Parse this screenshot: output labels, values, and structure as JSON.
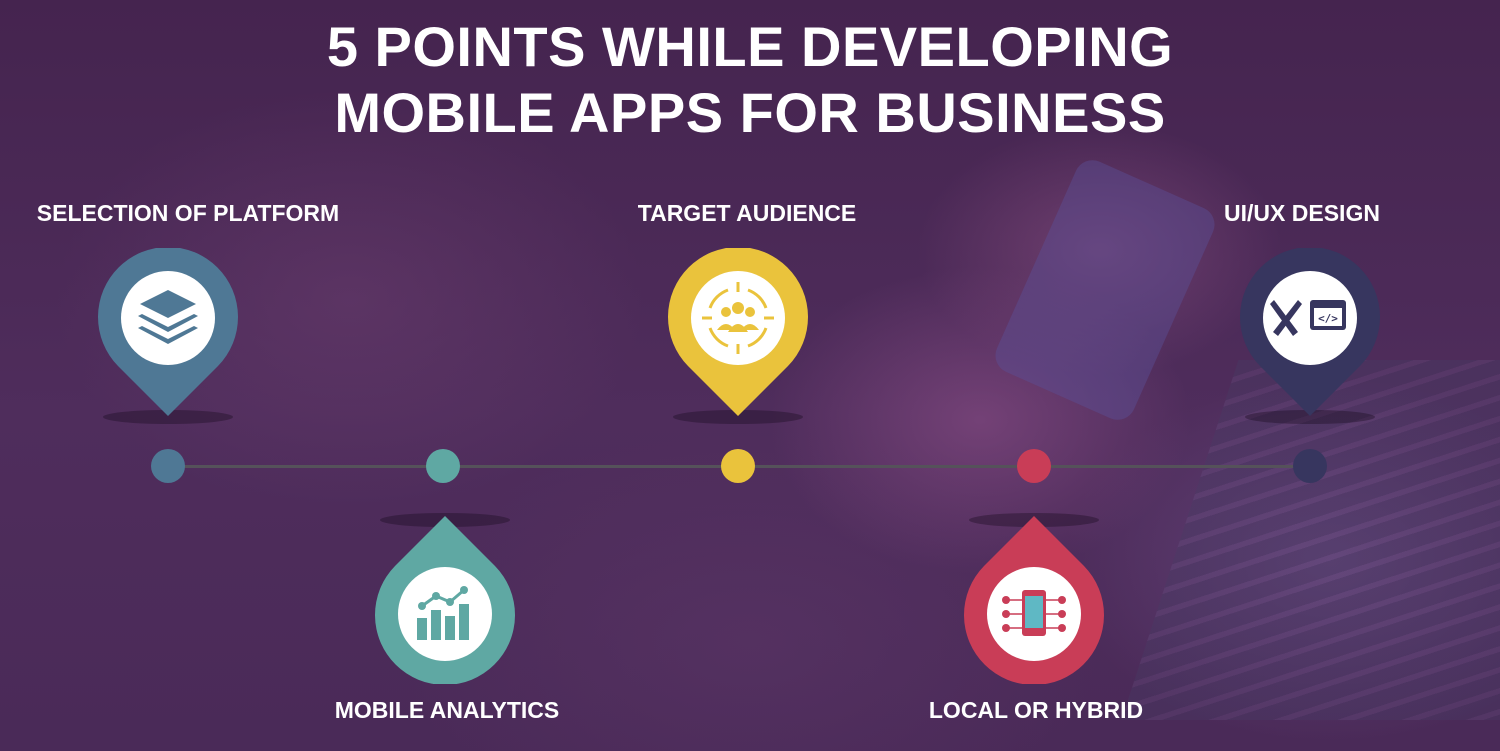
{
  "title": {
    "line1": "5 POINTS WHILE DEVELOPING",
    "line2": "MOBILE APPS FOR BUSINESS"
  },
  "points": [
    {
      "label": "SELECTION OF PLATFORM",
      "icon": "layers-icon",
      "color": "#4f7895"
    },
    {
      "label": "MOBILE ANALYTICS",
      "icon": "analytics-chart-icon",
      "color": "#5fa8a3"
    },
    {
      "label": "TARGET AUDIENCE",
      "icon": "audience-target-icon",
      "color": "#eac33c"
    },
    {
      "label": "LOCAL OR HYBRID",
      "icon": "mobile-device-icon",
      "color": "#c93d57"
    },
    {
      "label": "UI/UX DESIGN",
      "icon": "design-code-icon",
      "color": "#37365f"
    }
  ]
}
